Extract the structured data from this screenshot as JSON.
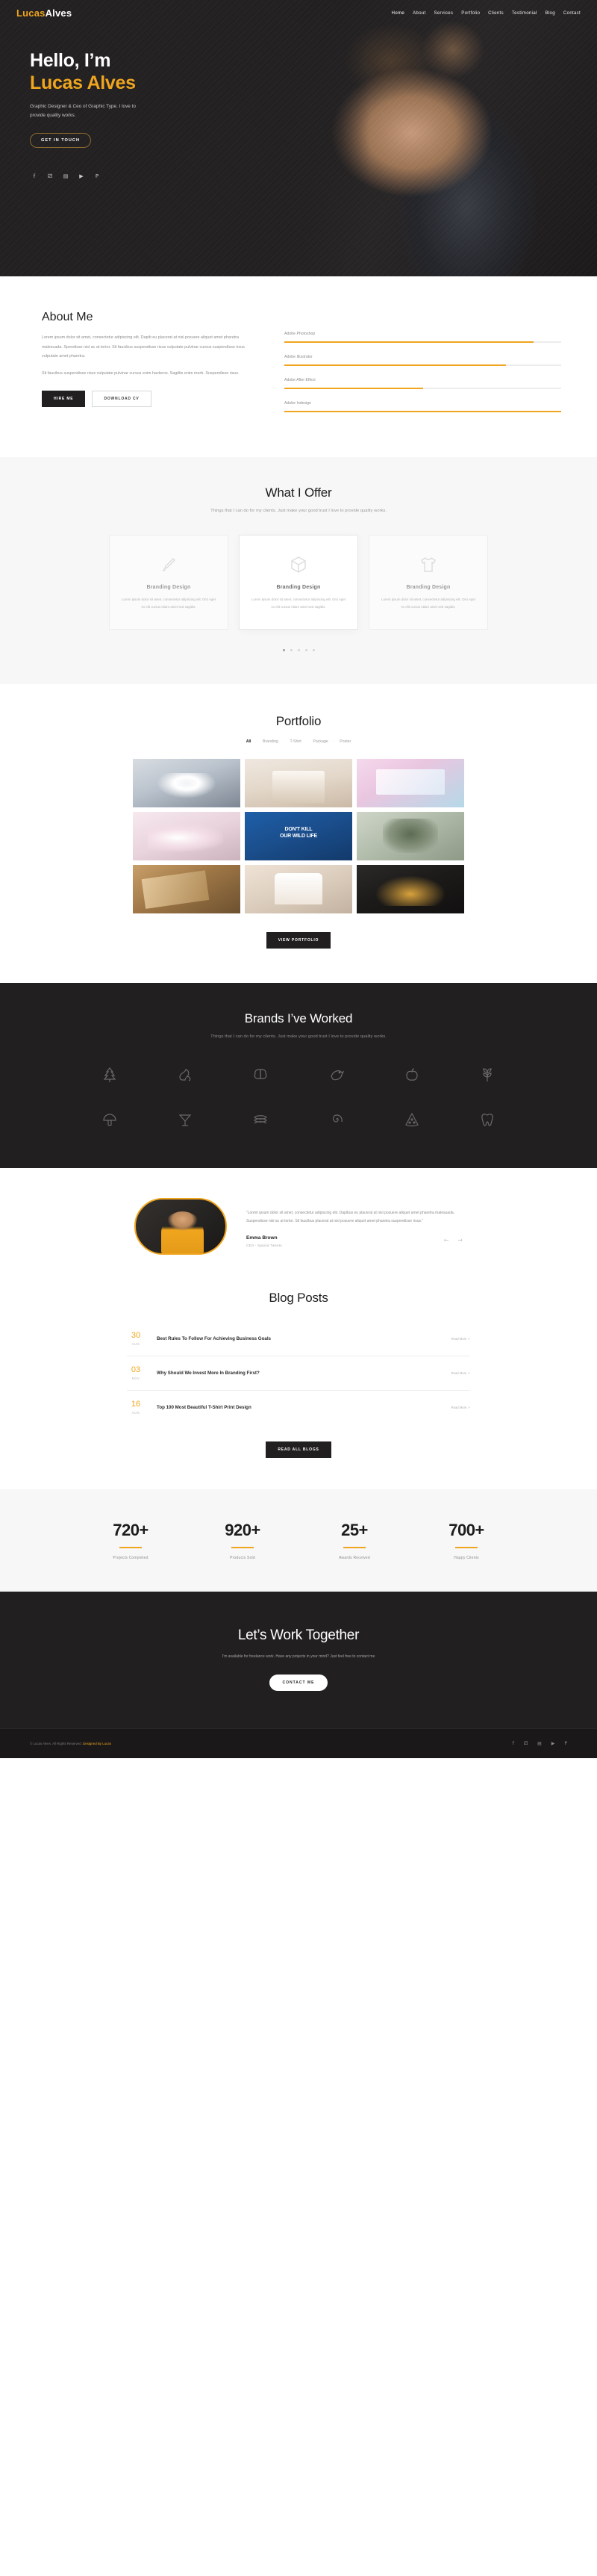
{
  "brand": {
    "first": "Lucas",
    "second": "Alves"
  },
  "nav": {
    "items": [
      {
        "label": "Home",
        "active": true
      },
      {
        "label": "About",
        "active": false
      },
      {
        "label": "Services",
        "active": false
      },
      {
        "label": "Portfolio",
        "active": false
      },
      {
        "label": "Clients",
        "active": false
      },
      {
        "label": "Testimonial",
        "active": false
      },
      {
        "label": "Blog",
        "active": false
      },
      {
        "label": "Contact",
        "active": false
      }
    ]
  },
  "hero": {
    "greeting": "Hello, I’m",
    "name": "Lucas Alves",
    "tagline": "Graphic Designer & Ceo of Graphic Type. I love to provide quality works.",
    "cta": "GET IN TOUCH",
    "socials": [
      "facebook-icon",
      "twitter-icon",
      "linkedin-icon",
      "youtube-icon",
      "pinterest-icon"
    ],
    "social_glyphs": [
      "f",
      "⁀",
      "in",
      "▶",
      "P"
    ]
  },
  "about": {
    "title": "About Me",
    "paragraphs": [
      "Lorem ipsum dolor sit amet, consectetur adipiscing elit. Dapib eu placerat at nisl posuere aliquet amet pharetra malesuada. Spendisse nisl ac at tortor. Sit faucibus suspendisse risus vulputate pulvinar cursus suspendisse risus vulputate amet pharetra.",
      "Sit faucibus suspendisse risus vulputate pulvinar cursus enim hacteros. Sagittis enim morb. Suspendisse risus."
    ],
    "hire_label": "HIRE ME",
    "download_label": "DOWNLOAD CV",
    "skills": [
      {
        "label": "Adobe Photoshop",
        "value": 90
      },
      {
        "label": "Adobe Illustrator",
        "value": 80
      },
      {
        "label": "Adobe After Effect",
        "value": 50
      },
      {
        "label": "Adobe Indesign",
        "value": 100
      }
    ]
  },
  "offer": {
    "title": "What I Offer",
    "subtitle": "Things that I can do for my clients. Just make your good trust I love to provide quality works.",
    "cards": [
      {
        "icon": "brush-icon",
        "title": "Branding Design",
        "text": "Lorem ipsum dolor sit amet, consectetur adipiscing elit. Orci eget ex elit cursus etiam amet sed sagittis."
      },
      {
        "icon": "package-icon",
        "title": "Branding Design",
        "text": "Lorem ipsum dolor sit amet, consectetur adipiscing elit. Orci eget ex elit cursus etiam amet sed sagittis."
      },
      {
        "icon": "tshirt-icon",
        "title": "Branding Design",
        "text": "Lorem ipsum dolor sit amet, consectetur adipiscing elit. Orci eget ex elit cursus etiam amet sed sagittis."
      }
    ],
    "dots": 5,
    "active_dot": 0
  },
  "portfolio": {
    "title": "Portfolio",
    "filters": [
      {
        "label": "All",
        "active": true
      },
      {
        "label": "Branding",
        "active": false
      },
      {
        "label": "T-Shirt",
        "active": false
      },
      {
        "label": "Package",
        "active": false
      },
      {
        "label": "Poster",
        "active": false
      }
    ],
    "items": [
      {
        "name": "aquas-tshirt"
      },
      {
        "name": "cosmetic-bottles"
      },
      {
        "name": "package-box"
      },
      {
        "name": "pink-packaging"
      },
      {
        "name": "dont-kill-our-wild-life-poster"
      },
      {
        "name": "camo-tshirt"
      },
      {
        "name": "food-board"
      },
      {
        "name": "woman-white-tshirt"
      },
      {
        "name": "coffee-bottles"
      }
    ],
    "button": "VIEW PORTFOLIO"
  },
  "brands": {
    "title": "Brands I’ve Worked",
    "subtitle": "Things that I can do for my clients. Just make your good trust I love to provide quality works.",
    "logos": [
      "tree-icon",
      "squirrel-icon",
      "brain-icon",
      "bird-icon",
      "apple-icon",
      "wheat-icon",
      "mushroom-icon",
      "cocktail-icon",
      "layers-icon",
      "spiral-icon",
      "pizza-icon",
      "tooth-icon"
    ]
  },
  "testimonial": {
    "quote": "“Lorem ipsum dolor sit amet, consectetur adipiscing elit. Dapibus eu placerat at nisl posuere aliquet amet pharetra malesuada. Suspendisse nisl ac at tortor. Sit faucibus placerat at nisl posuere aliquet amet pharetra suspendisse risus.”",
    "name": "Emma Brown",
    "role": "CEO - Spaind Tweets",
    "prev": "←",
    "next": "→"
  },
  "blog": {
    "title": "Blog Posts",
    "posts": [
      {
        "day": "30",
        "month": "AUG",
        "title": "Best Rules To Follow For Achieving Business Goals",
        "more": "Read More ↗"
      },
      {
        "day": "03",
        "month": "NOV",
        "title": "Why Should We Invest More In Branding First?",
        "more": "Read More ↗"
      },
      {
        "day": "16",
        "month": "AUG",
        "title": "Top 100 Most Beautiful T-Shirt Print Design",
        "more": "Read More ↗"
      }
    ],
    "button": "READ ALL BLOGS"
  },
  "counters": [
    {
      "num": "720+",
      "label": "Projects Completed"
    },
    {
      "num": "920+",
      "label": "Products Sold"
    },
    {
      "num": "25+",
      "label": "Awards Received"
    },
    {
      "num": "700+",
      "label": "Happy Clients"
    }
  ],
  "cta": {
    "title": "Let’s Work Together",
    "text": "I’m available for freelance work. Have any projects in your mind? Just feel free to contact me",
    "button": "CONTACT ME"
  },
  "footer": {
    "copyright_pre": "© Lucas Alves. All Rights Reserved.",
    "copyright_hl": " Designed By Lucas",
    "socials": [
      "facebook-icon",
      "twitter-icon",
      "linkedin-icon",
      "youtube-icon",
      "pinterest-icon"
    ],
    "social_glyphs": [
      "f",
      "⁀",
      "in",
      "▶",
      "P"
    ]
  },
  "colors": {
    "accent": "#f0a51e",
    "dark": "#211f20",
    "light": "#f7f7f7"
  }
}
